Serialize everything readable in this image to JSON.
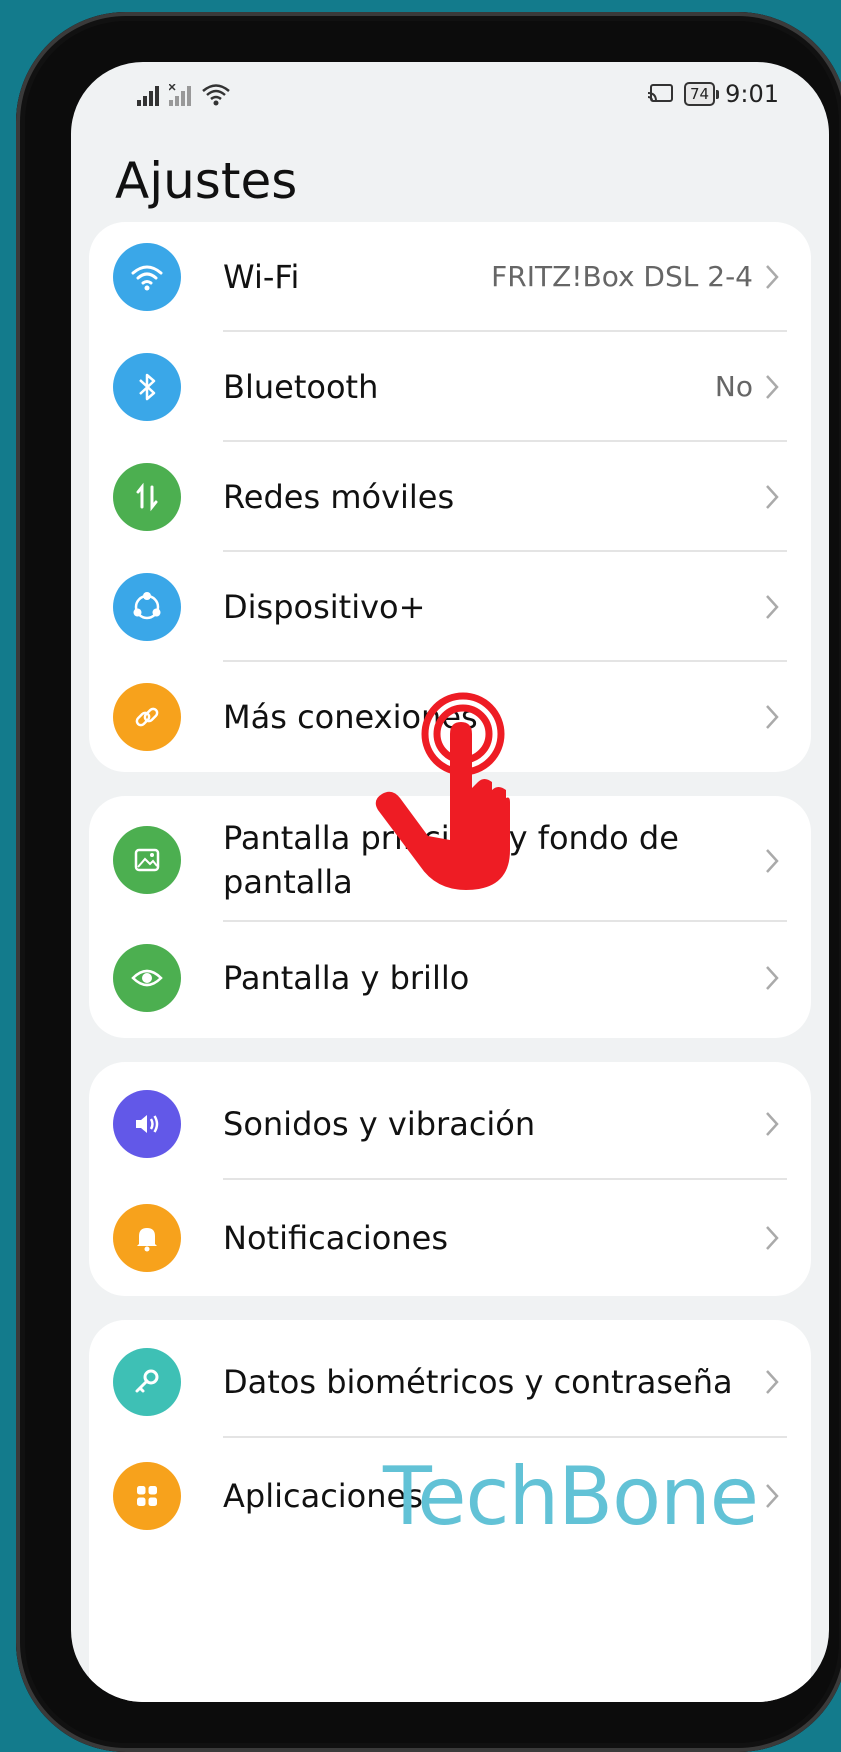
{
  "status_bar": {
    "battery": "74",
    "time": "9:01"
  },
  "page": {
    "title": "Ajustes"
  },
  "colors": {
    "background": "#137b8c",
    "wifi": "#3aa7e8",
    "bluetooth": "#3aa7e8",
    "mobile": "#4caf50",
    "device": "#3aa7e8",
    "connections": "#f7a21c",
    "wallpaper": "#4caf50",
    "display": "#4caf50",
    "sound": "#6258e8",
    "notifications": "#f7a21c",
    "biometrics": "#3ec0b5",
    "apps": "#f7a21c",
    "tap_hand": "#ee1c24"
  },
  "groups": [
    {
      "items": [
        {
          "label": "Wi-Fi",
          "value": "FRITZ!Box DSL 2-4",
          "icon": "wifi-icon"
        },
        {
          "label": "Bluetooth",
          "value": "No",
          "icon": "bluetooth-icon"
        },
        {
          "label": "Redes móviles",
          "icon": "mobile-data-icon"
        },
        {
          "label": "Dispositivo+",
          "icon": "device-plus-icon"
        },
        {
          "label": "Más conexiones",
          "icon": "link-icon"
        }
      ]
    },
    {
      "items": [
        {
          "label": "Pantalla principal y fondo de",
          "label_line2": "pantalla",
          "icon": "wallpaper-icon"
        },
        {
          "label": "Pantalla y brillo",
          "icon": "eye-icon"
        }
      ]
    },
    {
      "items": [
        {
          "label": "Sonidos y vibración",
          "icon": "speaker-icon"
        },
        {
          "label": "Notificaciones",
          "icon": "bell-icon"
        }
      ]
    },
    {
      "items": [
        {
          "label": "Datos biométricos y contraseña",
          "icon": "key-icon"
        },
        {
          "label": "Aplicaciones",
          "icon": "apps-icon"
        }
      ]
    }
  ],
  "watermark": "TechBone"
}
